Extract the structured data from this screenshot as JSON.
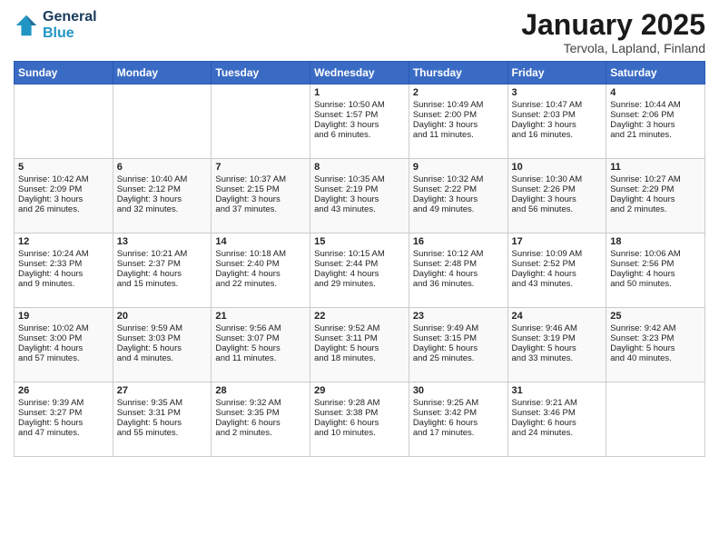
{
  "header": {
    "logo_line1": "General",
    "logo_line2": "Blue",
    "title": "January 2025",
    "subtitle": "Tervola, Lapland, Finland"
  },
  "weekdays": [
    "Sunday",
    "Monday",
    "Tuesday",
    "Wednesday",
    "Thursday",
    "Friday",
    "Saturday"
  ],
  "weeks": [
    [
      {
        "day": "",
        "content": ""
      },
      {
        "day": "",
        "content": ""
      },
      {
        "day": "",
        "content": ""
      },
      {
        "day": "1",
        "content": "Sunrise: 10:50 AM\nSunset: 1:57 PM\nDaylight: 3 hours\nand 6 minutes."
      },
      {
        "day": "2",
        "content": "Sunrise: 10:49 AM\nSunset: 2:00 PM\nDaylight: 3 hours\nand 11 minutes."
      },
      {
        "day": "3",
        "content": "Sunrise: 10:47 AM\nSunset: 2:03 PM\nDaylight: 3 hours\nand 16 minutes."
      },
      {
        "day": "4",
        "content": "Sunrise: 10:44 AM\nSunset: 2:06 PM\nDaylight: 3 hours\nand 21 minutes."
      }
    ],
    [
      {
        "day": "5",
        "content": "Sunrise: 10:42 AM\nSunset: 2:09 PM\nDaylight: 3 hours\nand 26 minutes."
      },
      {
        "day": "6",
        "content": "Sunrise: 10:40 AM\nSunset: 2:12 PM\nDaylight: 3 hours\nand 32 minutes."
      },
      {
        "day": "7",
        "content": "Sunrise: 10:37 AM\nSunset: 2:15 PM\nDaylight: 3 hours\nand 37 minutes."
      },
      {
        "day": "8",
        "content": "Sunrise: 10:35 AM\nSunset: 2:19 PM\nDaylight: 3 hours\nand 43 minutes."
      },
      {
        "day": "9",
        "content": "Sunrise: 10:32 AM\nSunset: 2:22 PM\nDaylight: 3 hours\nand 49 minutes."
      },
      {
        "day": "10",
        "content": "Sunrise: 10:30 AM\nSunset: 2:26 PM\nDaylight: 3 hours\nand 56 minutes."
      },
      {
        "day": "11",
        "content": "Sunrise: 10:27 AM\nSunset: 2:29 PM\nDaylight: 4 hours\nand 2 minutes."
      }
    ],
    [
      {
        "day": "12",
        "content": "Sunrise: 10:24 AM\nSunset: 2:33 PM\nDaylight: 4 hours\nand 9 minutes."
      },
      {
        "day": "13",
        "content": "Sunrise: 10:21 AM\nSunset: 2:37 PM\nDaylight: 4 hours\nand 15 minutes."
      },
      {
        "day": "14",
        "content": "Sunrise: 10:18 AM\nSunset: 2:40 PM\nDaylight: 4 hours\nand 22 minutes."
      },
      {
        "day": "15",
        "content": "Sunrise: 10:15 AM\nSunset: 2:44 PM\nDaylight: 4 hours\nand 29 minutes."
      },
      {
        "day": "16",
        "content": "Sunrise: 10:12 AM\nSunset: 2:48 PM\nDaylight: 4 hours\nand 36 minutes."
      },
      {
        "day": "17",
        "content": "Sunrise: 10:09 AM\nSunset: 2:52 PM\nDaylight: 4 hours\nand 43 minutes."
      },
      {
        "day": "18",
        "content": "Sunrise: 10:06 AM\nSunset: 2:56 PM\nDaylight: 4 hours\nand 50 minutes."
      }
    ],
    [
      {
        "day": "19",
        "content": "Sunrise: 10:02 AM\nSunset: 3:00 PM\nDaylight: 4 hours\nand 57 minutes."
      },
      {
        "day": "20",
        "content": "Sunrise: 9:59 AM\nSunset: 3:03 PM\nDaylight: 5 hours\nand 4 minutes."
      },
      {
        "day": "21",
        "content": "Sunrise: 9:56 AM\nSunset: 3:07 PM\nDaylight: 5 hours\nand 11 minutes."
      },
      {
        "day": "22",
        "content": "Sunrise: 9:52 AM\nSunset: 3:11 PM\nDaylight: 5 hours\nand 18 minutes."
      },
      {
        "day": "23",
        "content": "Sunrise: 9:49 AM\nSunset: 3:15 PM\nDaylight: 5 hours\nand 25 minutes."
      },
      {
        "day": "24",
        "content": "Sunrise: 9:46 AM\nSunset: 3:19 PM\nDaylight: 5 hours\nand 33 minutes."
      },
      {
        "day": "25",
        "content": "Sunrise: 9:42 AM\nSunset: 3:23 PM\nDaylight: 5 hours\nand 40 minutes."
      }
    ],
    [
      {
        "day": "26",
        "content": "Sunrise: 9:39 AM\nSunset: 3:27 PM\nDaylight: 5 hours\nand 47 minutes."
      },
      {
        "day": "27",
        "content": "Sunrise: 9:35 AM\nSunset: 3:31 PM\nDaylight: 5 hours\nand 55 minutes."
      },
      {
        "day": "28",
        "content": "Sunrise: 9:32 AM\nSunset: 3:35 PM\nDaylight: 6 hours\nand 2 minutes."
      },
      {
        "day": "29",
        "content": "Sunrise: 9:28 AM\nSunset: 3:38 PM\nDaylight: 6 hours\nand 10 minutes."
      },
      {
        "day": "30",
        "content": "Sunrise: 9:25 AM\nSunset: 3:42 PM\nDaylight: 6 hours\nand 17 minutes."
      },
      {
        "day": "31",
        "content": "Sunrise: 9:21 AM\nSunset: 3:46 PM\nDaylight: 6 hours\nand 24 minutes."
      },
      {
        "day": "",
        "content": ""
      }
    ]
  ]
}
